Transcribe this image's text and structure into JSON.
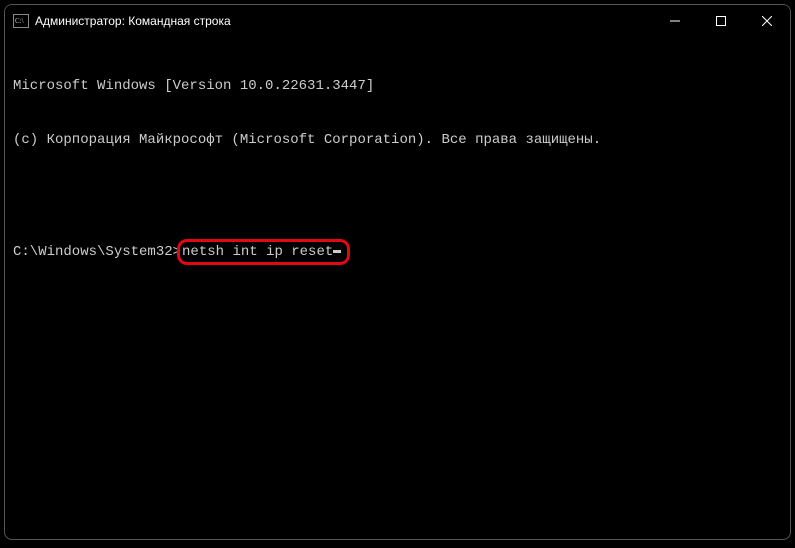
{
  "titlebar": {
    "title": "Администратор: Командная строка"
  },
  "terminal": {
    "line1": "Microsoft Windows [Version 10.0.22631.3447]",
    "line2": "(c) Корпорация Майкрософт (Microsoft Corporation). Все права защищены.",
    "prompt": "C:\\Windows\\System32>",
    "command": "netsh int ip reset"
  }
}
